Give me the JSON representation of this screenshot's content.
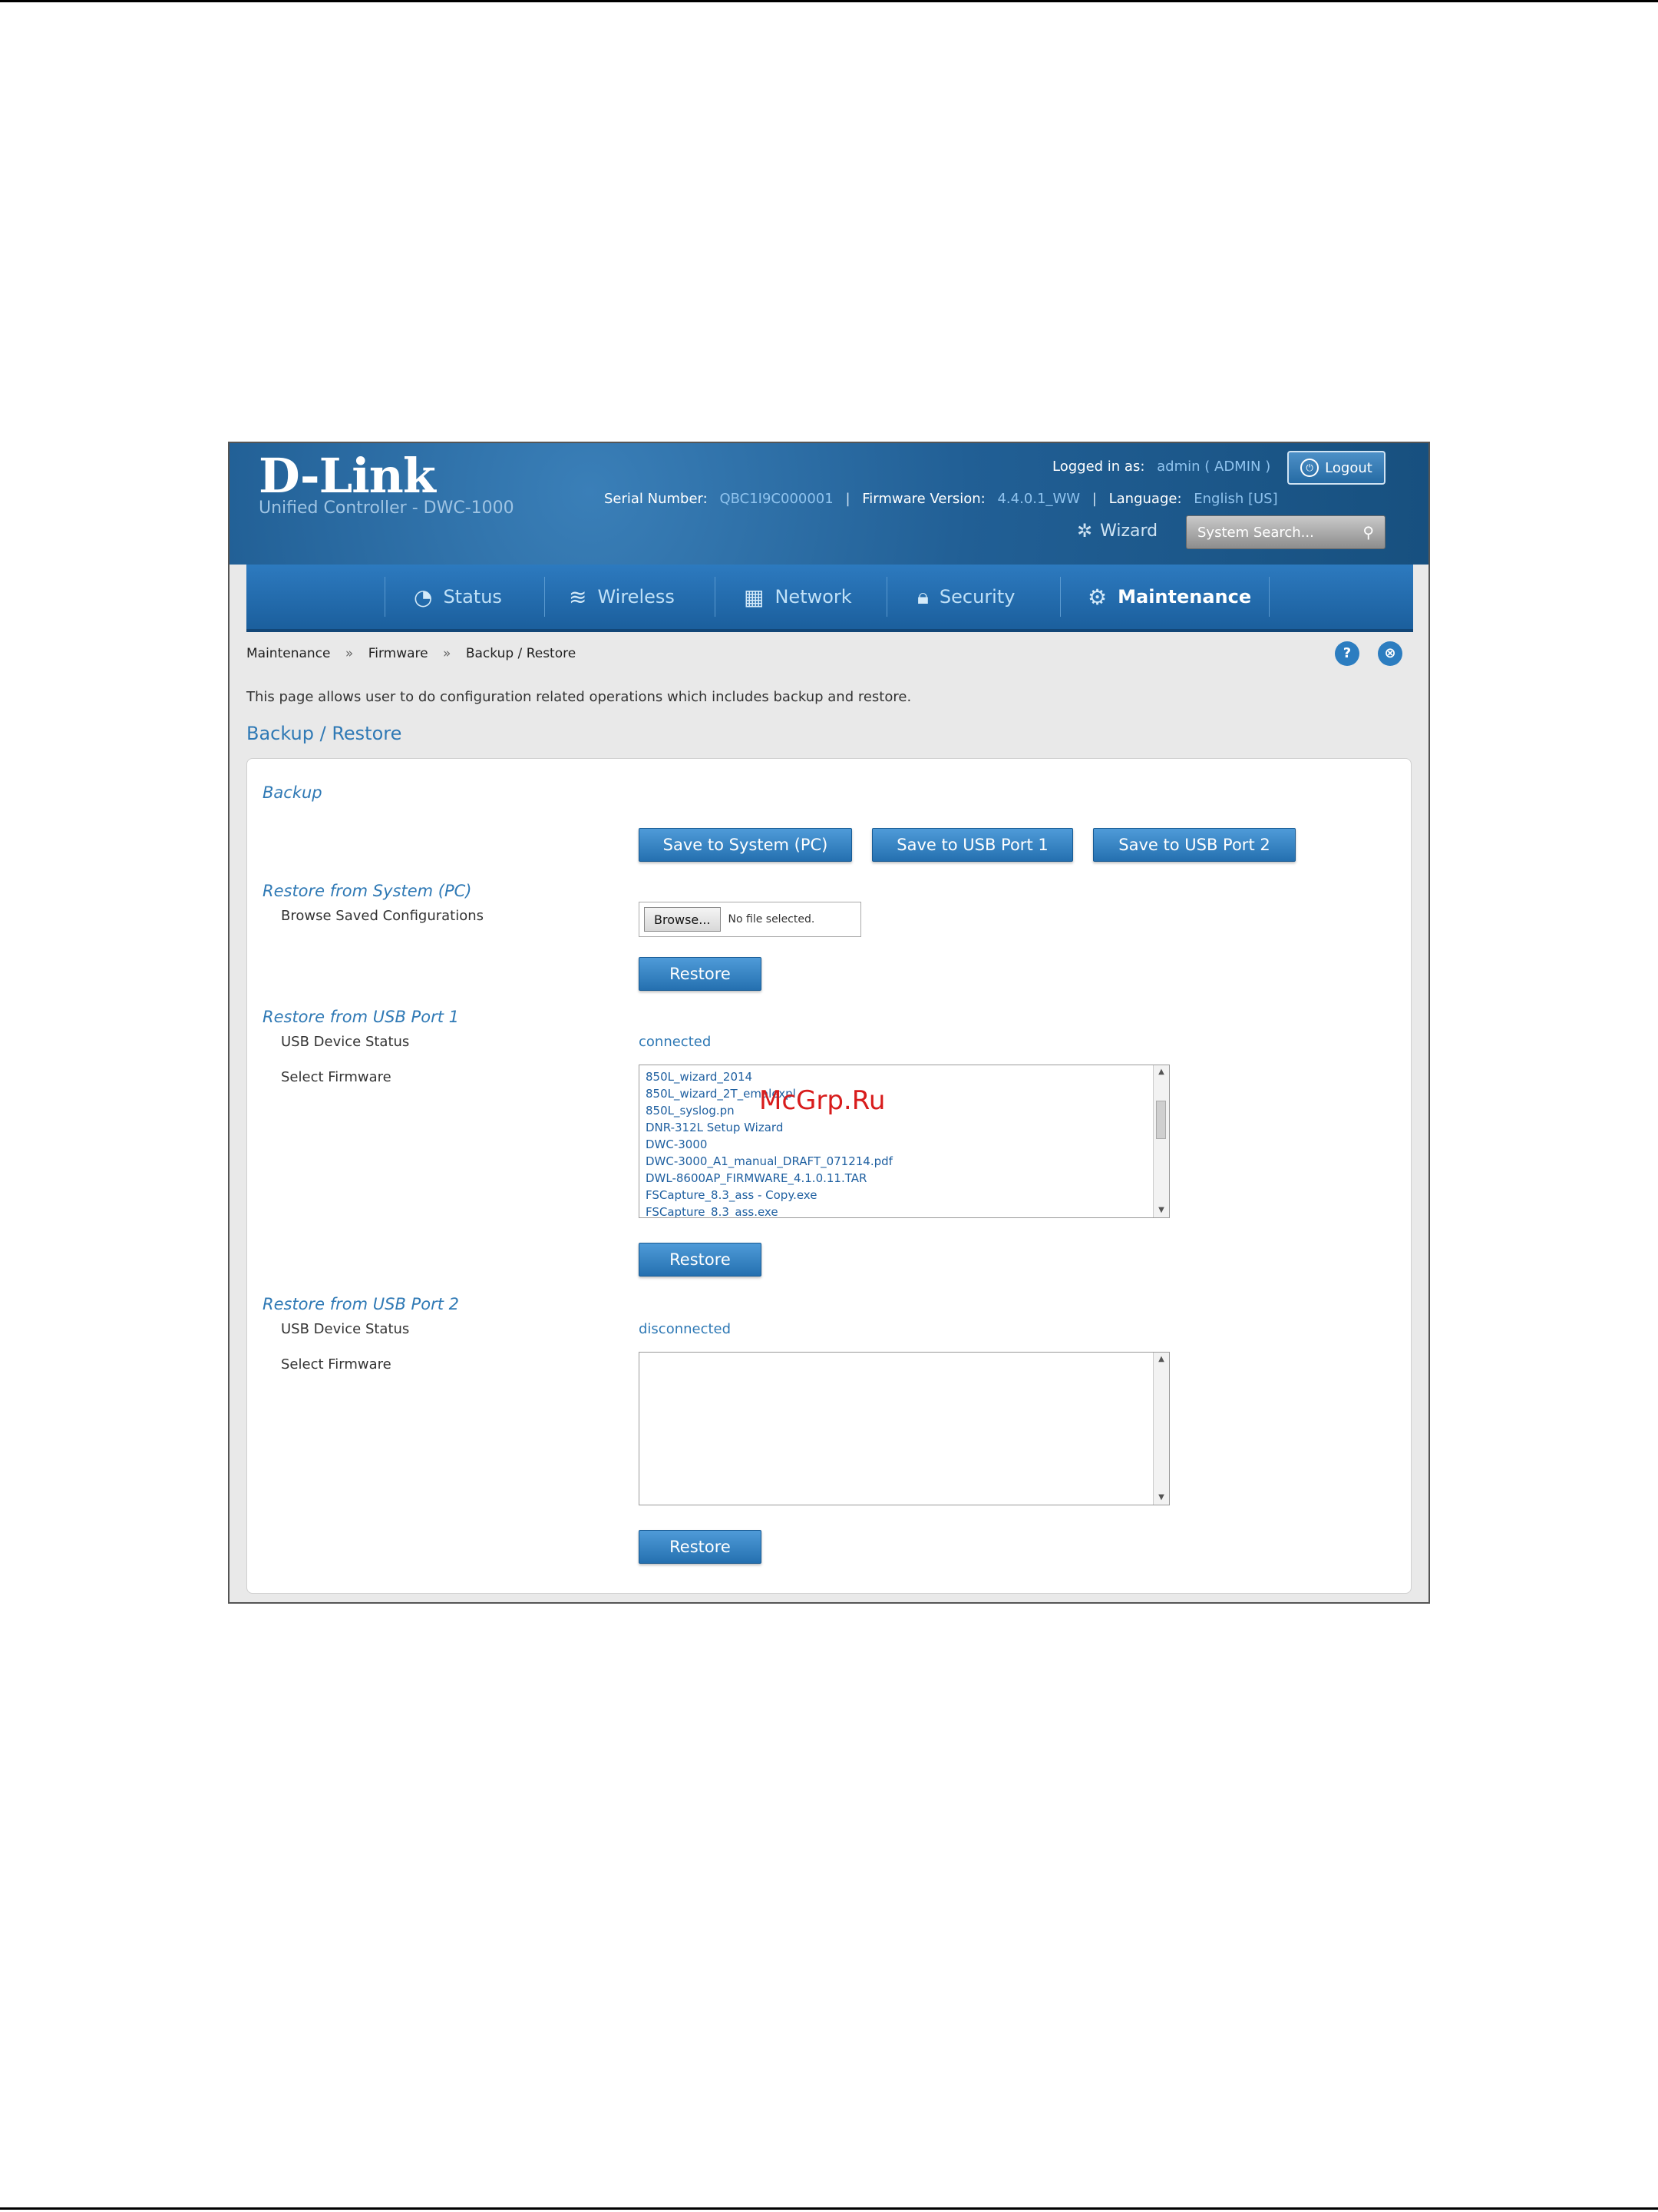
{
  "header": {
    "logo": "D-Link",
    "product": "Unified Controller - DWC-1000",
    "logged_in_label": "Logged in as:",
    "logged_in_user": "admin ( ADMIN )",
    "logout_label": "Logout",
    "serial_label": "Serial Number:",
    "serial_value": "QBC1I9C000001",
    "firmware_label": "Firmware Version:",
    "firmware_value": "4.4.0.1_WW",
    "language_label": "Language:",
    "language_value": "English [US]",
    "wizard_label": "Wizard",
    "search_placeholder": "System Search..."
  },
  "nav": {
    "items": [
      {
        "label": "Status",
        "icon": "gauge-icon"
      },
      {
        "label": "Wireless",
        "icon": "wifi-icon"
      },
      {
        "label": "Network",
        "icon": "network-icon"
      },
      {
        "label": "Security",
        "icon": "lock-icon"
      },
      {
        "label": "Maintenance",
        "icon": "gears-icon",
        "active": true
      }
    ]
  },
  "breadcrumb": [
    "Maintenance",
    "Firmware",
    "Backup / Restore"
  ],
  "page": {
    "description": "This page allows user to do configuration related operations which includes backup and restore.",
    "title": "Backup / Restore"
  },
  "backup": {
    "heading": "Backup",
    "buttons": [
      "Save to System (PC)",
      "Save to USB Port 1",
      "Save to USB Port 2"
    ]
  },
  "restore_pc": {
    "heading": "Restore from System (PC)",
    "browse_label": "Browse Saved Configurations",
    "browse_button": "Browse...",
    "no_file": "No file selected.",
    "restore_button": "Restore"
  },
  "restore_usb1": {
    "heading": "Restore from USB Port 1",
    "status_label": "USB Device Status",
    "status_value": "connected",
    "select_label": "Select Firmware",
    "files": [
      "850L_wizard_2014",
      "850L_wizard_2T_emalexpl",
      "850L_syslog.pn",
      "DNR-312L Setup Wizard",
      "DWC-3000",
      "DWC-3000_A1_manual_DRAFT_071214.pdf",
      "DWL-8600AP_FIRMWARE_4.1.0.11.TAR",
      "FSCapture_8.3_ass - Copy.exe",
      "FSCapture_8.3_ass.exe"
    ],
    "restore_button": "Restore"
  },
  "restore_usb2": {
    "heading": "Restore from USB Port 2",
    "status_label": "USB Device Status",
    "status_value": "disconnected",
    "select_label": "Select Firmware",
    "restore_button": "Restore"
  },
  "watermark": "McGrp.Ru",
  "colors": {
    "accent": "#2f79b5",
    "header_bg": "#215f95",
    "button_blue": "#2570b0"
  }
}
